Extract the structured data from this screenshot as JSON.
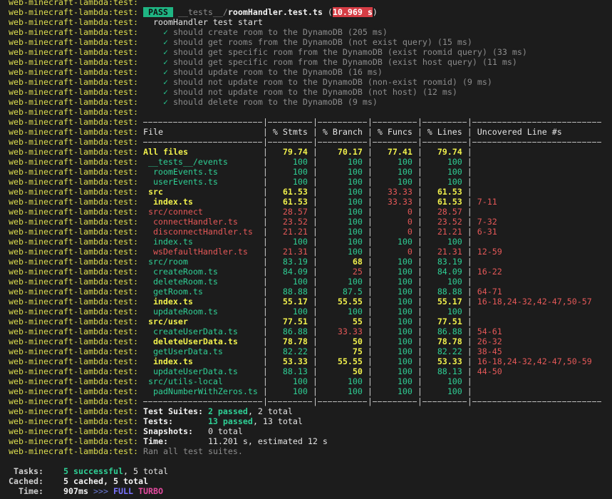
{
  "prefix": "web-minecraft-lambda:test:",
  "result": {
    "badge": "PASS",
    "dir": "__tests__/",
    "file": "roomHandler.test.ts",
    "open": " (",
    "duration": "10.969 s",
    "close": ")"
  },
  "suite_title": "roomHandler test start",
  "check_icon": "✓",
  "tests": [
    "should create room to the DynamoDB (205 ms)",
    "should get rooms from the DynamoDB (not exist query) (15 ms)",
    "should get specific room from the DynamoDB (exist roomid query) (33 ms)",
    "should get specific room from the DynamoDB (exist host query) (11 ms)",
    "should update room to the DynamoDB (16 ms)",
    "should not update room to the DynamoDB (non-exist roomid) (9 ms)",
    "should not update room to the DynamoDB (not host) (12 ms)",
    "should delete room to the DynamoDB (9 ms)"
  ],
  "coverage": {
    "headers": [
      "File",
      "% Stmts",
      "% Branch",
      "% Funcs",
      "% Lines",
      "Uncovered Line #s"
    ],
    "rows": [
      {
        "file": "All files",
        "level": 0,
        "stmts": "79.74",
        "branch": "70.17",
        "funcs": "77.41",
        "lines": "79.74",
        "uncovered": ""
      },
      {
        "file": "__tests__/events",
        "level": 1,
        "stmts": "100",
        "branch": "100",
        "funcs": "100",
        "lines": "100",
        "uncovered": ""
      },
      {
        "file": "roomEvents.ts",
        "level": 2,
        "stmts": "100",
        "branch": "100",
        "funcs": "100",
        "lines": "100",
        "uncovered": ""
      },
      {
        "file": "userEvents.ts",
        "level": 2,
        "stmts": "100",
        "branch": "100",
        "funcs": "100",
        "lines": "100",
        "uncovered": ""
      },
      {
        "file": "src",
        "level": 1,
        "stmts": "61.53",
        "branch": "100",
        "funcs": "33.33",
        "lines": "61.53",
        "uncovered": ""
      },
      {
        "file": "index.ts",
        "level": 2,
        "stmts": "61.53",
        "branch": "100",
        "funcs": "33.33",
        "lines": "61.53",
        "uncovered": "7-11"
      },
      {
        "file": "src/connect",
        "level": 1,
        "stmts": "28.57",
        "branch": "100",
        "funcs": "0",
        "lines": "28.57",
        "uncovered": ""
      },
      {
        "file": "connectHandler.ts",
        "level": 2,
        "stmts": "23.52",
        "branch": "100",
        "funcs": "0",
        "lines": "23.52",
        "uncovered": "7-32"
      },
      {
        "file": "disconnectHandler.ts",
        "level": 2,
        "stmts": "21.21",
        "branch": "100",
        "funcs": "0",
        "lines": "21.21",
        "uncovered": "6-31"
      },
      {
        "file": "index.ts",
        "level": 2,
        "stmts": "100",
        "branch": "100",
        "funcs": "100",
        "lines": "100",
        "uncovered": ""
      },
      {
        "file": "wsDefaultHandler.ts",
        "level": 2,
        "stmts": "21.31",
        "branch": "100",
        "funcs": "0",
        "lines": "21.31",
        "uncovered": "12-59"
      },
      {
        "file": "src/room",
        "level": 1,
        "stmts": "83.19",
        "branch": "68",
        "funcs": "100",
        "lines": "83.19",
        "uncovered": ""
      },
      {
        "file": "createRoom.ts",
        "level": 2,
        "stmts": "84.09",
        "branch": "25",
        "funcs": "100",
        "lines": "84.09",
        "uncovered": "16-22"
      },
      {
        "file": "deleteRoom.ts",
        "level": 2,
        "stmts": "100",
        "branch": "100",
        "funcs": "100",
        "lines": "100",
        "uncovered": ""
      },
      {
        "file": "getRoom.ts",
        "level": 2,
        "stmts": "88.88",
        "branch": "87.5",
        "funcs": "100",
        "lines": "88.88",
        "uncovered": "64-71"
      },
      {
        "file": "index.ts",
        "level": 2,
        "stmts": "55.17",
        "branch": "55.55",
        "funcs": "100",
        "lines": "55.17",
        "uncovered": "16-18,24-32,42-47,50-57"
      },
      {
        "file": "updateRoom.ts",
        "level": 2,
        "stmts": "100",
        "branch": "100",
        "funcs": "100",
        "lines": "100",
        "uncovered": ""
      },
      {
        "file": "src/user",
        "level": 1,
        "stmts": "77.51",
        "branch": "55",
        "funcs": "100",
        "lines": "77.51",
        "uncovered": ""
      },
      {
        "file": "createUserData.ts",
        "level": 2,
        "stmts": "86.88",
        "branch": "33.33",
        "funcs": "100",
        "lines": "86.88",
        "uncovered": "54-61"
      },
      {
        "file": "deleteUserData.ts",
        "level": 2,
        "stmts": "78.78",
        "branch": "50",
        "funcs": "100",
        "lines": "78.78",
        "uncovered": "26-32"
      },
      {
        "file": "getUserData.ts",
        "level": 2,
        "stmts": "82.22",
        "branch": "75",
        "funcs": "100",
        "lines": "82.22",
        "uncovered": "38-45"
      },
      {
        "file": "index.ts",
        "level": 2,
        "stmts": "53.33",
        "branch": "55.55",
        "funcs": "100",
        "lines": "53.33",
        "uncovered": "16-18,24-32,42-47,50-59"
      },
      {
        "file": "updateUserData.ts",
        "level": 2,
        "stmts": "88.13",
        "branch": "50",
        "funcs": "100",
        "lines": "88.13",
        "uncovered": "44-50"
      },
      {
        "file": "src/utils-local",
        "level": 1,
        "stmts": "100",
        "branch": "100",
        "funcs": "100",
        "lines": "100",
        "uncovered": ""
      },
      {
        "file": "padNumberWithZeros.ts",
        "level": 2,
        "stmts": "100",
        "branch": "100",
        "funcs": "100",
        "lines": "100",
        "uncovered": ""
      }
    ]
  },
  "summary": {
    "suites": {
      "label": "Test Suites:",
      "passed": "2 passed",
      "rest": ", 2 total"
    },
    "tests": {
      "label": "Tests:",
      "passed": "13 passed",
      "rest": ", 13 total"
    },
    "snapshots": {
      "label": "Snapshots:",
      "value": "0 total"
    },
    "time": {
      "label": "Time:",
      "value": "11.201 s, estimated 12 s"
    },
    "ran": "Ran all test suites."
  },
  "turbo": {
    "tasks": {
      "label": "Tasks:",
      "ok": "5 successful",
      "rest": ", 5 total"
    },
    "cached": {
      "label": "Cached:",
      "value": "5 cached, 5 total"
    },
    "time": {
      "label": "Time:",
      "value": "907ms",
      "arrows": ">>>",
      "full": "FULL",
      "turbo": "TURBO"
    }
  },
  "colors": {
    "background": "#1c1c1c",
    "prefix": "#dede4e",
    "high": "#2fcf95",
    "medium": "#f0f04c",
    "low": "#e55858",
    "pass_badge": "#1fb583",
    "slow_badge": "#d63d45"
  }
}
